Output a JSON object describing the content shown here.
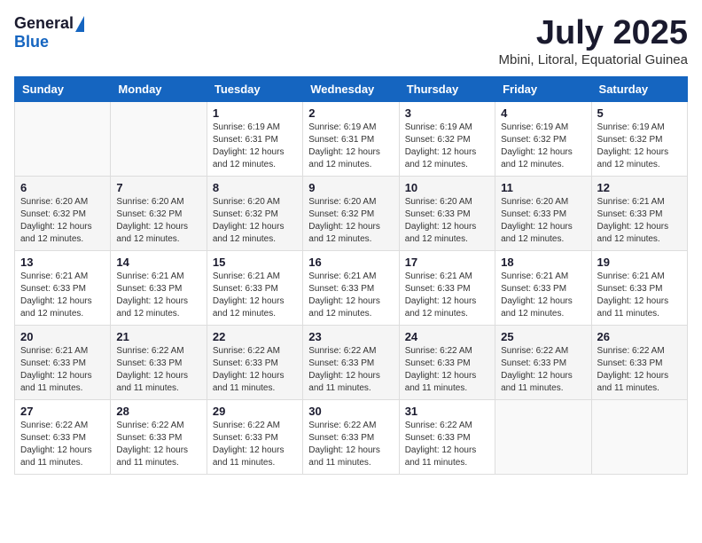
{
  "logo": {
    "general": "General",
    "blue": "Blue"
  },
  "title": {
    "month_year": "July 2025",
    "location": "Mbini, Litoral, Equatorial Guinea"
  },
  "headers": [
    "Sunday",
    "Monday",
    "Tuesday",
    "Wednesday",
    "Thursday",
    "Friday",
    "Saturday"
  ],
  "weeks": [
    [
      {
        "day": "",
        "info": ""
      },
      {
        "day": "",
        "info": ""
      },
      {
        "day": "1",
        "info": "Sunrise: 6:19 AM\nSunset: 6:31 PM\nDaylight: 12 hours and 12 minutes."
      },
      {
        "day": "2",
        "info": "Sunrise: 6:19 AM\nSunset: 6:31 PM\nDaylight: 12 hours and 12 minutes."
      },
      {
        "day": "3",
        "info": "Sunrise: 6:19 AM\nSunset: 6:32 PM\nDaylight: 12 hours and 12 minutes."
      },
      {
        "day": "4",
        "info": "Sunrise: 6:19 AM\nSunset: 6:32 PM\nDaylight: 12 hours and 12 minutes."
      },
      {
        "day": "5",
        "info": "Sunrise: 6:19 AM\nSunset: 6:32 PM\nDaylight: 12 hours and 12 minutes."
      }
    ],
    [
      {
        "day": "6",
        "info": "Sunrise: 6:20 AM\nSunset: 6:32 PM\nDaylight: 12 hours and 12 minutes."
      },
      {
        "day": "7",
        "info": "Sunrise: 6:20 AM\nSunset: 6:32 PM\nDaylight: 12 hours and 12 minutes."
      },
      {
        "day": "8",
        "info": "Sunrise: 6:20 AM\nSunset: 6:32 PM\nDaylight: 12 hours and 12 minutes."
      },
      {
        "day": "9",
        "info": "Sunrise: 6:20 AM\nSunset: 6:32 PM\nDaylight: 12 hours and 12 minutes."
      },
      {
        "day": "10",
        "info": "Sunrise: 6:20 AM\nSunset: 6:33 PM\nDaylight: 12 hours and 12 minutes."
      },
      {
        "day": "11",
        "info": "Sunrise: 6:20 AM\nSunset: 6:33 PM\nDaylight: 12 hours and 12 minutes."
      },
      {
        "day": "12",
        "info": "Sunrise: 6:21 AM\nSunset: 6:33 PM\nDaylight: 12 hours and 12 minutes."
      }
    ],
    [
      {
        "day": "13",
        "info": "Sunrise: 6:21 AM\nSunset: 6:33 PM\nDaylight: 12 hours and 12 minutes."
      },
      {
        "day": "14",
        "info": "Sunrise: 6:21 AM\nSunset: 6:33 PM\nDaylight: 12 hours and 12 minutes."
      },
      {
        "day": "15",
        "info": "Sunrise: 6:21 AM\nSunset: 6:33 PM\nDaylight: 12 hours and 12 minutes."
      },
      {
        "day": "16",
        "info": "Sunrise: 6:21 AM\nSunset: 6:33 PM\nDaylight: 12 hours and 12 minutes."
      },
      {
        "day": "17",
        "info": "Sunrise: 6:21 AM\nSunset: 6:33 PM\nDaylight: 12 hours and 12 minutes."
      },
      {
        "day": "18",
        "info": "Sunrise: 6:21 AM\nSunset: 6:33 PM\nDaylight: 12 hours and 12 minutes."
      },
      {
        "day": "19",
        "info": "Sunrise: 6:21 AM\nSunset: 6:33 PM\nDaylight: 12 hours and 11 minutes."
      }
    ],
    [
      {
        "day": "20",
        "info": "Sunrise: 6:21 AM\nSunset: 6:33 PM\nDaylight: 12 hours and 11 minutes."
      },
      {
        "day": "21",
        "info": "Sunrise: 6:22 AM\nSunset: 6:33 PM\nDaylight: 12 hours and 11 minutes."
      },
      {
        "day": "22",
        "info": "Sunrise: 6:22 AM\nSunset: 6:33 PM\nDaylight: 12 hours and 11 minutes."
      },
      {
        "day": "23",
        "info": "Sunrise: 6:22 AM\nSunset: 6:33 PM\nDaylight: 12 hours and 11 minutes."
      },
      {
        "day": "24",
        "info": "Sunrise: 6:22 AM\nSunset: 6:33 PM\nDaylight: 12 hours and 11 minutes."
      },
      {
        "day": "25",
        "info": "Sunrise: 6:22 AM\nSunset: 6:33 PM\nDaylight: 12 hours and 11 minutes."
      },
      {
        "day": "26",
        "info": "Sunrise: 6:22 AM\nSunset: 6:33 PM\nDaylight: 12 hours and 11 minutes."
      }
    ],
    [
      {
        "day": "27",
        "info": "Sunrise: 6:22 AM\nSunset: 6:33 PM\nDaylight: 12 hours and 11 minutes."
      },
      {
        "day": "28",
        "info": "Sunrise: 6:22 AM\nSunset: 6:33 PM\nDaylight: 12 hours and 11 minutes."
      },
      {
        "day": "29",
        "info": "Sunrise: 6:22 AM\nSunset: 6:33 PM\nDaylight: 12 hours and 11 minutes."
      },
      {
        "day": "30",
        "info": "Sunrise: 6:22 AM\nSunset: 6:33 PM\nDaylight: 12 hours and 11 minutes."
      },
      {
        "day": "31",
        "info": "Sunrise: 6:22 AM\nSunset: 6:33 PM\nDaylight: 12 hours and 11 minutes."
      },
      {
        "day": "",
        "info": ""
      },
      {
        "day": "",
        "info": ""
      }
    ]
  ]
}
